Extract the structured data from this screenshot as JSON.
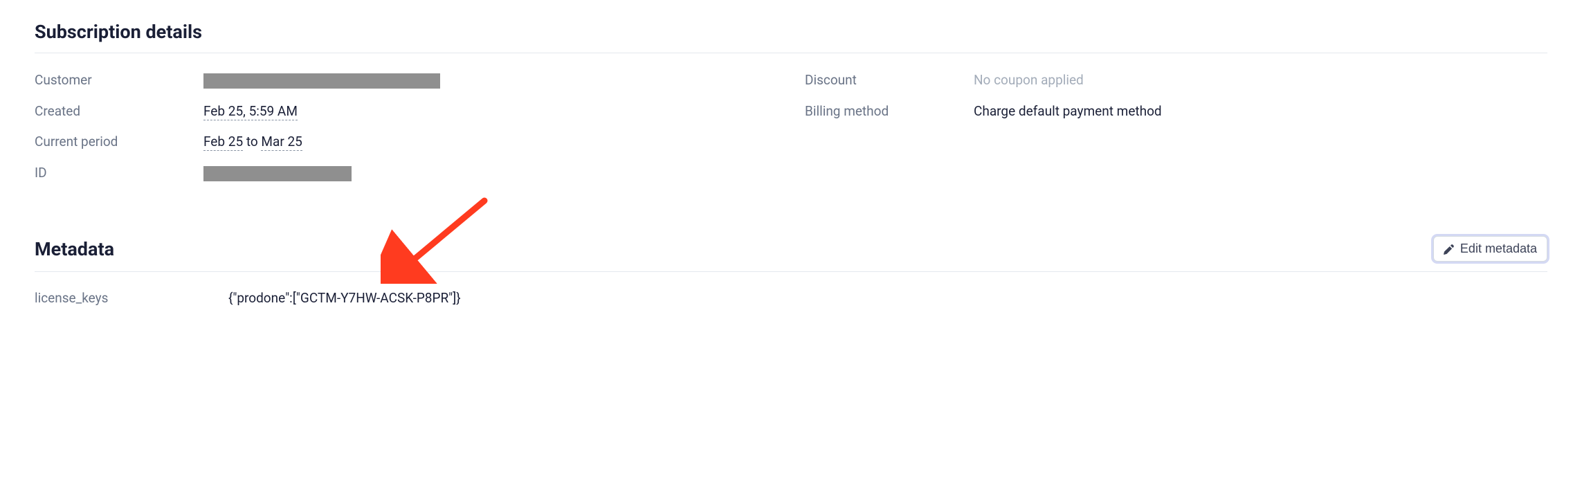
{
  "subscription": {
    "title": "Subscription details",
    "fields": {
      "customer_label": "Customer",
      "created_label": "Created",
      "created_value": "Feb 25, 5:59 AM",
      "current_period_label": "Current period",
      "current_period_from": "Feb 25",
      "current_period_to_word": " to ",
      "current_period_to": "Mar 25",
      "id_label": "ID",
      "discount_label": "Discount",
      "discount_value": "No coupon applied",
      "billing_method_label": "Billing method",
      "billing_method_value": "Charge default payment method"
    }
  },
  "metadata": {
    "title": "Metadata",
    "edit_label": "Edit metadata",
    "entries": {
      "license_keys_label": "license_keys",
      "license_keys_value": "{\"prodone\":[\"GCTM-Y7HW-ACSK-P8PR\"]}"
    }
  }
}
